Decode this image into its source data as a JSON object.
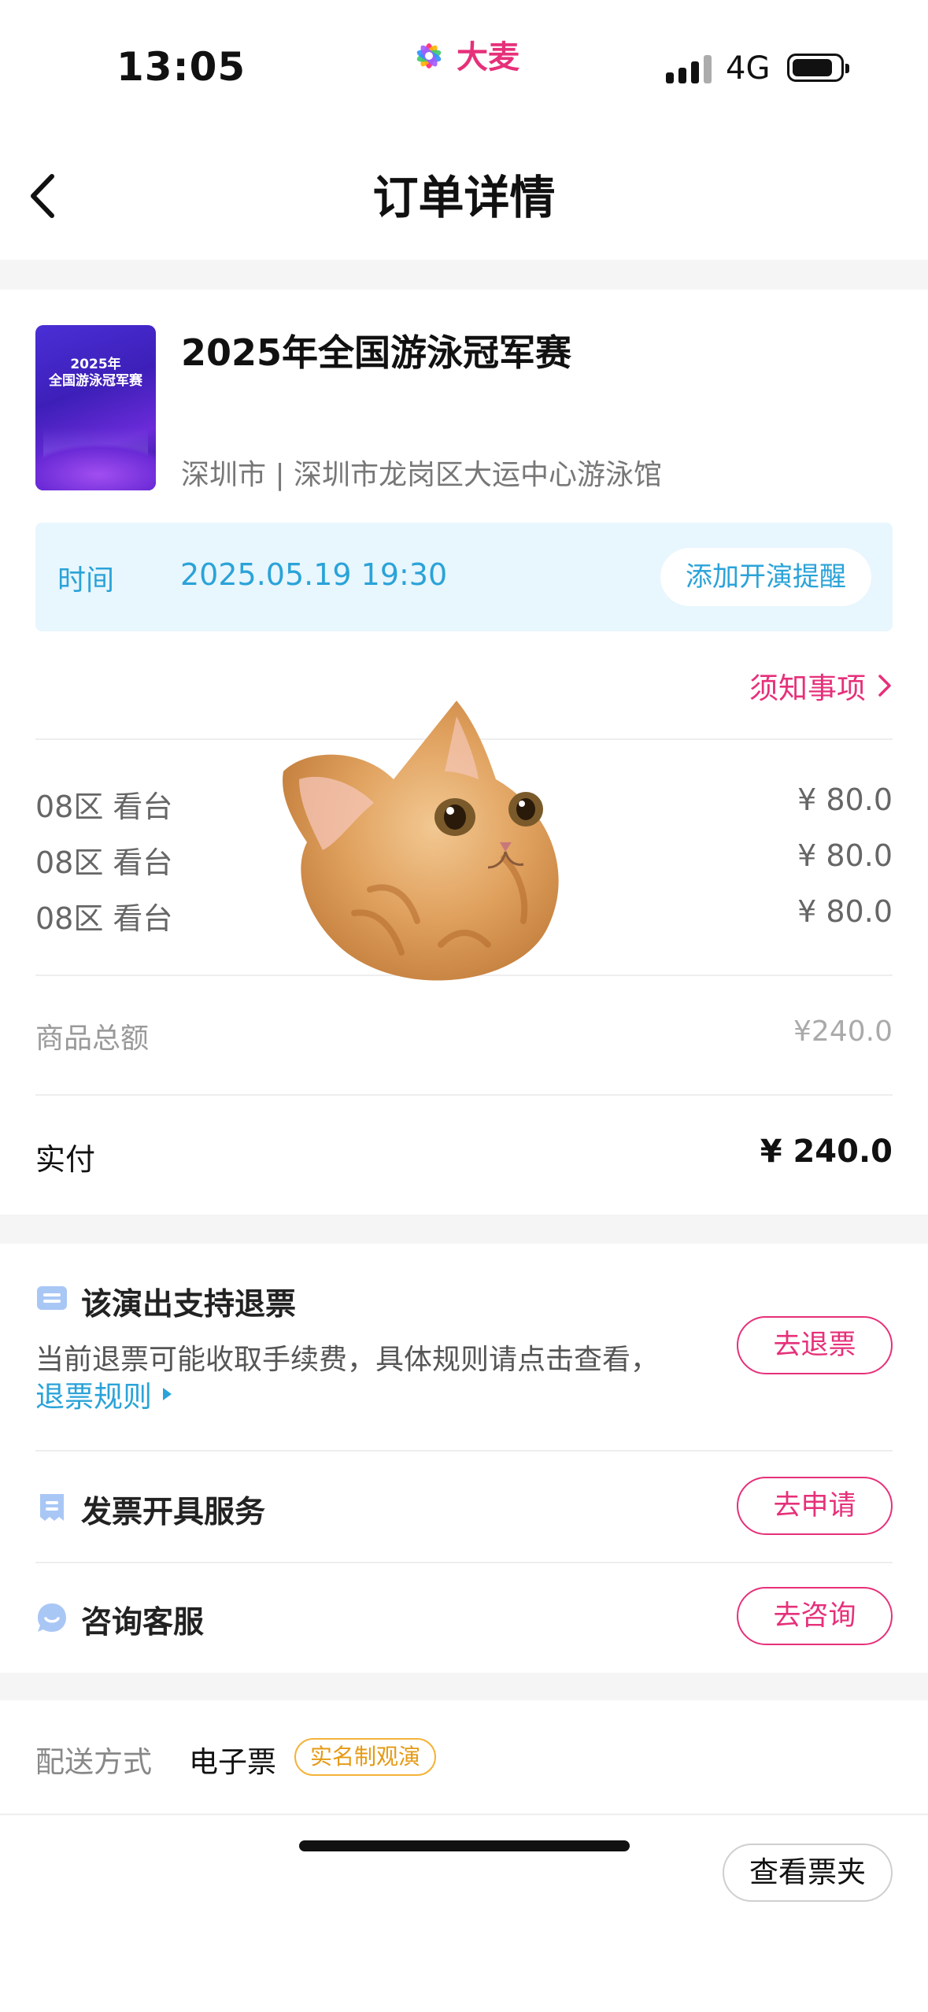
{
  "status_bar": {
    "time": "13:05",
    "brand": "大麦",
    "network": "4G"
  },
  "nav": {
    "title": "订单详情"
  },
  "event": {
    "poster_year": "2025年",
    "poster_title": "全国游泳冠军赛",
    "title": "2025年全国游泳冠军赛",
    "venue": "深圳市 | 深圳市龙岗区大运中心游泳馆",
    "time_label": "时间",
    "time_value": "2025.05.19 19:30",
    "remind_label": "添加开演提醒",
    "notice_label": "须知事项"
  },
  "tickets": [
    {
      "zone": "08区 看台",
      "price": "¥ 80.0"
    },
    {
      "zone": "08区 看台",
      "price": "¥ 80.0"
    },
    {
      "zone": "08区 看台",
      "price": "¥ 80.0"
    }
  ],
  "summary": {
    "subtotal_label": "商品总额",
    "subtotal_value": "¥240.0",
    "paid_label": "实付",
    "paid_value": "¥ 240.0"
  },
  "services": {
    "refund_title": "该演出支持退票",
    "refund_desc": "当前退票可能收取手续费，具体规则请点击查看，",
    "refund_rules": "退票规则",
    "refund_button": "去退票",
    "invoice_title": "发票开具服务",
    "invoice_button": "去申请",
    "support_title": "咨询客服",
    "support_button": "去咨询"
  },
  "delivery": {
    "label": "配送方式",
    "value": "电子票",
    "badge": "实名制观演",
    "wallet_button": "查看票夹"
  },
  "colors": {
    "accent_pink": "#e6307a",
    "accent_blue": "#2aa3d8",
    "badge_orange": "#e59a14"
  }
}
